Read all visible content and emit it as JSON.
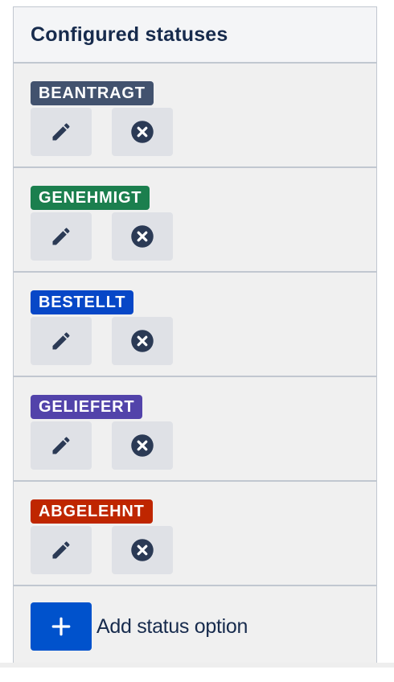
{
  "panel": {
    "title": "Configured statuses"
  },
  "statuses": [
    {
      "label": "BEANTRAGT",
      "color": "#42526e"
    },
    {
      "label": "GENEHMIGT",
      "color": "#1b7f4e"
    },
    {
      "label": "BESTELLT",
      "color": "#0747c7"
    },
    {
      "label": "GELIEFERT",
      "color": "#5243aa"
    },
    {
      "label": "ABGELEHNT",
      "color": "#bf2600"
    }
  ],
  "actions": {
    "edit_icon": "pencil-icon",
    "remove_icon": "close-circle-icon",
    "add_icon": "plus-icon"
  },
  "add_option": {
    "label": "Add status option",
    "color": "#0052cc"
  },
  "colors": {
    "icon": "#2b3a55",
    "icon_button_bg": "#dfe1e6",
    "text": "#172b4d"
  }
}
